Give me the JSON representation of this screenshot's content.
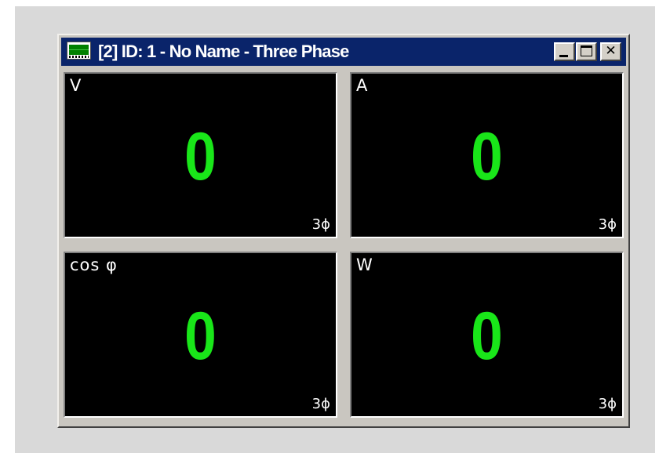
{
  "window": {
    "title": "[2] ID: 1 - No Name - Three Phase",
    "icon": "meter-display-icon",
    "controls": {
      "minimize": "minimize-icon",
      "maximize": "maximize-icon",
      "close_glyph": "✕"
    }
  },
  "colors": {
    "titlebar": "#0a246a",
    "panel_background": "#000000",
    "value": "#19e619",
    "label": "#ffffff"
  },
  "panels": [
    {
      "quantity": "V",
      "value": "0",
      "phase": "3ϕ"
    },
    {
      "quantity": "A",
      "value": "0",
      "phase": "3ϕ"
    },
    {
      "quantity": "cos φ",
      "value": "0",
      "phase": "3ϕ"
    },
    {
      "quantity": "W",
      "value": "0",
      "phase": "3ϕ"
    }
  ]
}
